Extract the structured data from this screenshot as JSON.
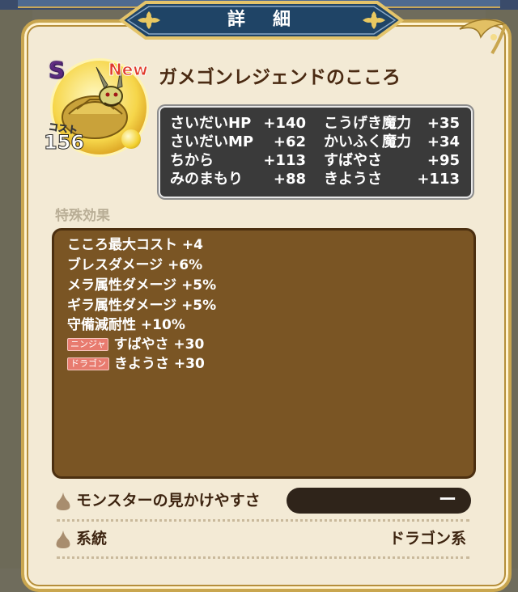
{
  "header": {
    "title": "詳　細"
  },
  "monster": {
    "rank": "S",
    "badge": "New",
    "name": "ガメゴンレジェンドのこころ",
    "cost_label": "コスト",
    "cost_value": "156"
  },
  "stats": {
    "left": [
      {
        "label": "さいだいHP",
        "value": "+140"
      },
      {
        "label": "さいだいMP",
        "value": "+62"
      },
      {
        "label": "ちから",
        "value": "+113"
      },
      {
        "label": "みのまもり",
        "value": "+88"
      }
    ],
    "right": [
      {
        "label": "こうげき魔力",
        "value": "+35"
      },
      {
        "label": "かいふく魔力",
        "value": "+34"
      },
      {
        "label": "すばやさ",
        "value": "+95"
      },
      {
        "label": "きようさ",
        "value": "+113"
      }
    ]
  },
  "special": {
    "label": "特殊効果",
    "effects": [
      {
        "tag": "",
        "text": "こころ最大コスト +4"
      },
      {
        "tag": "",
        "text": "ブレスダメージ +6%"
      },
      {
        "tag": "",
        "text": "メラ属性ダメージ +5%"
      },
      {
        "tag": "",
        "text": "ギラ属性ダメージ +5%"
      },
      {
        "tag": "",
        "text": "守備減耐性 +10%"
      },
      {
        "tag": "ニンジャ",
        "text": "すばやさ +30"
      },
      {
        "tag": "ドラゴン",
        "text": "きようさ +30"
      }
    ]
  },
  "rows": {
    "visibility": {
      "label": "モンスターの見かけやすさ",
      "value": "ー"
    },
    "family": {
      "label": "系統",
      "value": "ドラゴン系"
    }
  },
  "colors": {
    "accent_gold": "#c9a64f",
    "panel": "#f3ead5",
    "effects_bg": "#7a5524",
    "stats_bg": "#3a3a3a"
  },
  "icons": [
    "chest-emblem-icon",
    "corner-ornament-icon",
    "onion-bullet-icon"
  ]
}
